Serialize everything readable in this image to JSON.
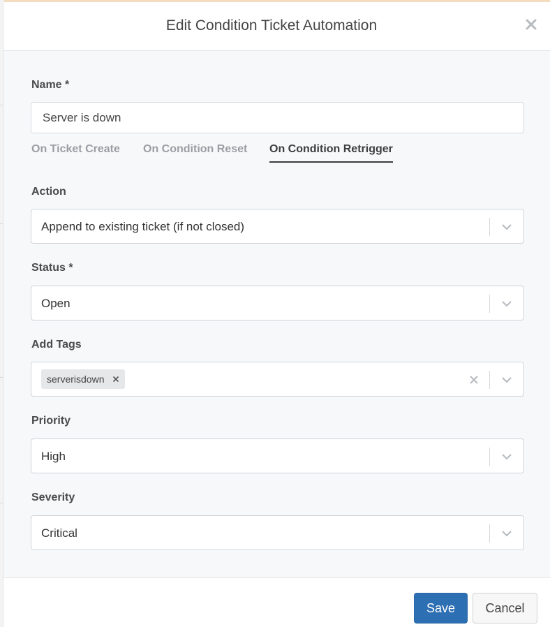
{
  "modal": {
    "title": "Edit Condition Ticket Automation"
  },
  "form": {
    "name_label": "Name *",
    "name_value": "Server is down",
    "tabs": [
      {
        "label": "On Ticket Create",
        "active": false
      },
      {
        "label": "On Condition Reset",
        "active": false
      },
      {
        "label": "On Condition Retrigger",
        "active": true
      }
    ],
    "action": {
      "label": "Action",
      "value": "Append to existing ticket (if not closed)"
    },
    "status": {
      "label": "Status *",
      "value": "Open"
    },
    "tags": {
      "label": "Add Tags",
      "items": [
        "serverisdown"
      ]
    },
    "priority": {
      "label": "Priority",
      "value": "High"
    },
    "severity": {
      "label": "Severity",
      "value": "Critical"
    }
  },
  "footer": {
    "save_label": "Save",
    "cancel_label": "Cancel"
  },
  "colors": {
    "primary": "#2d6fb3",
    "tab_active": "#3d3d3d",
    "tab_inactive": "#9a9ea3"
  }
}
